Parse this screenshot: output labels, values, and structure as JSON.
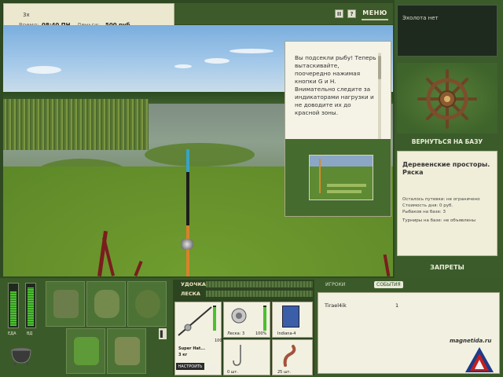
{
  "status": {
    "speed": "3x",
    "time_label": "Время:",
    "time": "08:40 ПН",
    "money_label": "Деньги:",
    "money": "500 руб."
  },
  "top": {
    "pause_icon": "pause-icon",
    "help_icon": "help-icon",
    "menu_label": "МЕНЮ"
  },
  "message": {
    "text": "Вы подсекли рыбу! Теперь вытаскивайте, поочередно нажимая кнопки G и H. Внимательно следите за индикаторами нагрузки и не доводите их до красной зоны."
  },
  "sidebar": {
    "echo_sounder": "Эхолота нет",
    "return_label": "ВЕРНУТЬСЯ НА БАЗУ",
    "location_title": "Деревенские просторы. Ряска",
    "trip_left": "Осталось путевки: не ограничено",
    "day_cost": "Стоимость дня: 0 руб.",
    "fishers_at_base": "Рыбаков на базе: 3",
    "tournaments": "Турниры на базе: не объявлены",
    "bans_label": "ЗАПРЕТЫ"
  },
  "gauges": {
    "left_label": "ЕДА",
    "right_label": "ВД",
    "left_level": 0.82,
    "right_level": 0.9
  },
  "tackle": {
    "rod_label": "УДОЧКА",
    "line_label": "ЛЕСКА",
    "rod_name": "Super Hat...",
    "rod_weight": "3 кг",
    "rod_percent": "100%",
    "reel_caption": "Леска: 3",
    "reel_percent": "100%",
    "lure_caption": "Indiana-4",
    "hook_caption": "0 шт.",
    "bait_caption": "25 шт.",
    "setup_label": "НАСТРОИТЬ"
  },
  "chat": {
    "tab_players": "ИГРОКИ",
    "tab_events": "СОБЫТИЯ",
    "player_name": "Tirael4ik",
    "player_score": "1"
  },
  "watermark": "magnetida.ru",
  "colors": {
    "panel_green": "#3b5a29",
    "panel_cream": "#f0eed9",
    "accent_red": "#c41e1e"
  }
}
